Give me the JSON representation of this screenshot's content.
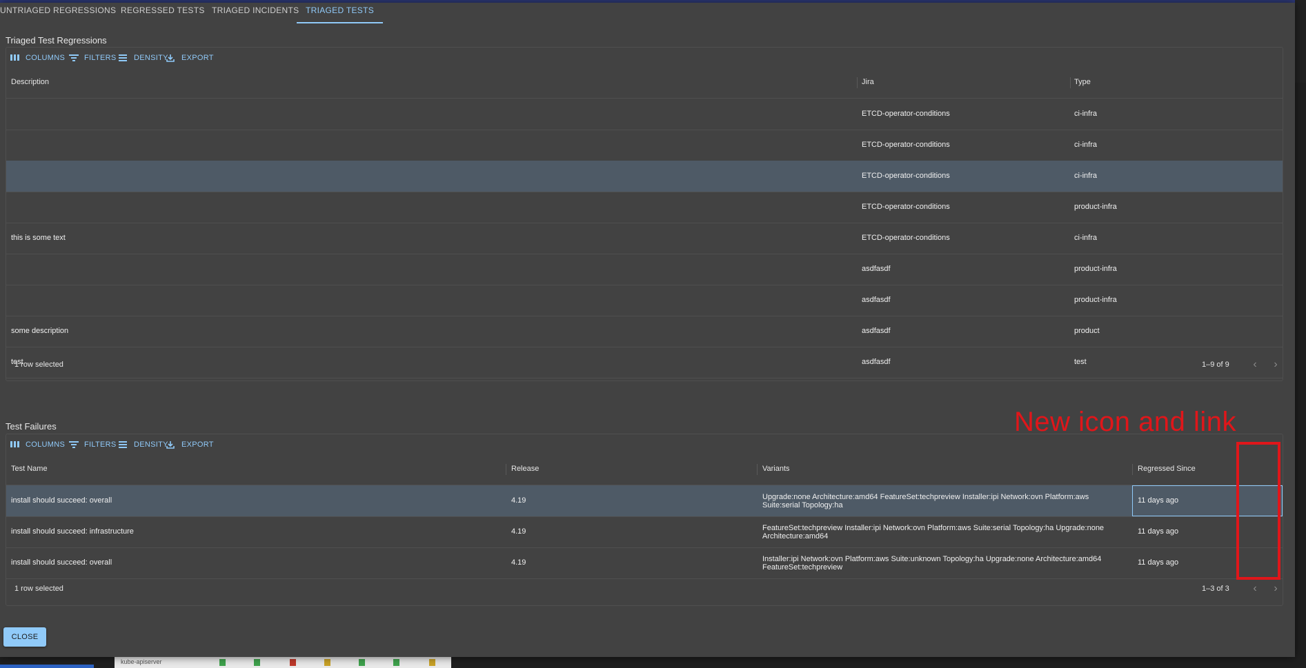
{
  "tabs": [
    {
      "label": "UNTRIAGED REGRESSIONS"
    },
    {
      "label": "REGRESSED TESTS"
    },
    {
      "label": "TRIAGED INCIDENTS"
    },
    {
      "label": "TRIAGED TESTS",
      "active": true
    }
  ],
  "toolbar": {
    "columns": "COLUMNS",
    "filters": "FILTERS",
    "density": "DENSITY",
    "export": "EXPORT"
  },
  "triaged": {
    "title": "Triaged Test Regressions",
    "headers": {
      "description": "Description",
      "jira": "Jira",
      "type": "Type"
    },
    "rows": [
      {
        "description": "",
        "jira": "ETCD-operator-conditions",
        "type": "ci-infra"
      },
      {
        "description": "",
        "jira": "ETCD-operator-conditions",
        "type": "ci-infra"
      },
      {
        "description": "",
        "jira": "ETCD-operator-conditions",
        "type": "ci-infra",
        "selected": true
      },
      {
        "description": "",
        "jira": "ETCD-operator-conditions",
        "type": "product-infra"
      },
      {
        "description": "this is some text",
        "jira": "ETCD-operator-conditions",
        "type": "ci-infra"
      },
      {
        "description": "",
        "jira": "asdfasdf",
        "type": "product-infra"
      },
      {
        "description": "",
        "jira": "asdfasdf",
        "type": "product-infra"
      },
      {
        "description": "some description",
        "jira": "asdfasdf",
        "type": "product"
      },
      {
        "description": "test",
        "jira": "asdfasdf",
        "type": "test"
      }
    ],
    "selection": "1 row selected",
    "pagination": "1–9 of 9"
  },
  "failures": {
    "title": "Test Failures",
    "headers": {
      "test_name": "Test Name",
      "release": "Release",
      "variants": "Variants",
      "regressed_since": "Regressed Since"
    },
    "rows": [
      {
        "test_name": "install should succeed: overall",
        "release": "4.19",
        "variants": "Upgrade:none Architecture:amd64 FeatureSet:techpreview Installer:ipi Network:ovn Platform:aws Suite:serial Topology:ha",
        "regressed_since": "11 days ago",
        "selected": true
      },
      {
        "test_name": "install should succeed: infrastructure",
        "release": "4.19",
        "variants": "FeatureSet:techpreview Installer:ipi Network:ovn Platform:aws Suite:serial Topology:ha Upgrade:none Architecture:amd64",
        "regressed_since": "11 days ago"
      },
      {
        "test_name": "install should succeed: overall",
        "release": "4.19",
        "variants": "Installer:ipi Network:ovn Platform:aws Suite:unknown Topology:ha Upgrade:none Architecture:amd64 FeatureSet:techpreview",
        "regressed_since": "11 days ago"
      }
    ],
    "selection": "1 row selected",
    "pagination": "1–3 of 3"
  },
  "close_label": "CLOSE",
  "annotation": {
    "text": "New icon and link",
    "color": "#e0161a"
  },
  "background": {
    "bottom_label": "kube-apiserver"
  },
  "colors": {
    "accent": "#90caf9",
    "dialog_bg": "#424242",
    "selected_row": "#4e5a66"
  }
}
